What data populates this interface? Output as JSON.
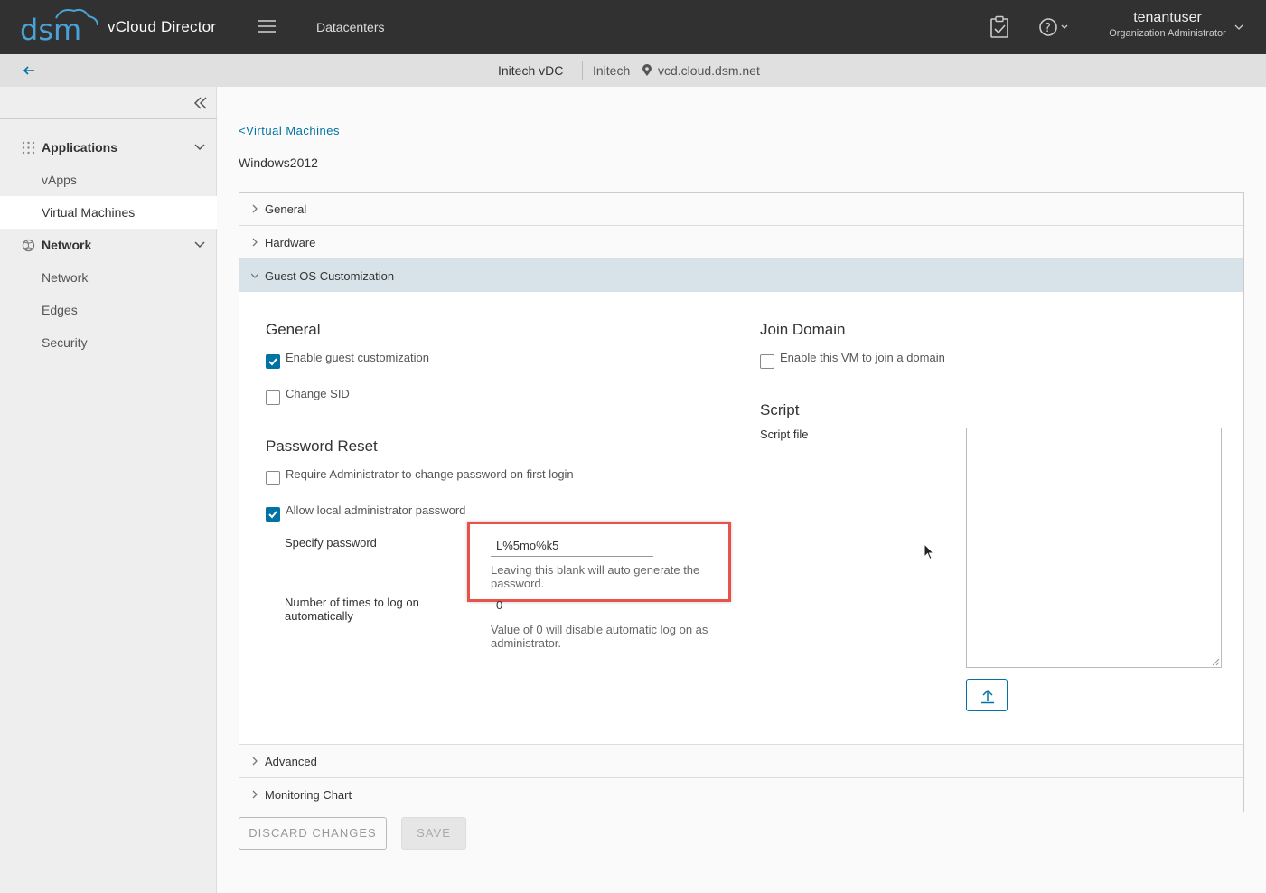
{
  "header": {
    "app_title": "vCloud Director",
    "nav_datacenters": "Datacenters",
    "user_name": "tenantuser",
    "user_role": "Organization Administrator"
  },
  "subheader": {
    "vdc": "Initech vDC",
    "org": "Initech",
    "host": "vcd.cloud.dsm.net"
  },
  "sidebar": {
    "groups": [
      {
        "label": "Applications",
        "items": [
          "vApps",
          "Virtual Machines"
        ]
      },
      {
        "label": "Network",
        "items": [
          "Network",
          "Edges",
          "Security"
        ]
      }
    ],
    "active_item": "Virtual Machines"
  },
  "main": {
    "breadcrumb": "<Virtual Machines",
    "title": "Windows2012",
    "sections": [
      "General",
      "Hardware",
      "Guest OS Customization",
      "Advanced",
      "Monitoring Chart"
    ],
    "open_section": "Guest OS Customization"
  },
  "guest_os": {
    "general_title": "General",
    "enable_customization_label": "Enable guest customization",
    "enable_customization_checked": true,
    "change_sid_label": "Change SID",
    "change_sid_checked": false,
    "password_reset_title": "Password Reset",
    "require_admin_change_label": "Require Administrator to change password on first login",
    "require_admin_change_checked": false,
    "allow_local_admin_label": "Allow local administrator password",
    "allow_local_admin_checked": true,
    "specify_password_label": "Specify password",
    "password_value": "L%5mo%k5",
    "password_help": "Leaving this blank will auto generate the password.",
    "autologon_label": "Number of times to log on automatically",
    "autologon_value": "0",
    "autologon_help": "Value of 0 will disable automatic log on as administrator.",
    "join_domain_title": "Join Domain",
    "join_domain_label": "Enable this VM to join a domain",
    "join_domain_checked": false,
    "script_title": "Script",
    "script_file_label": "Script file"
  },
  "buttons": {
    "discard": "DISCARD CHANGES",
    "save": "SAVE"
  },
  "icons": {
    "logo": "dsm-logo",
    "menu": "hamburger-icon",
    "tasks": "clipboard-check-icon",
    "help": "help-circle-icon",
    "back": "arrow-left-icon",
    "collapse": "double-chevron-left-icon",
    "upload": "upload-icon"
  },
  "colors": {
    "header_bg": "#313131",
    "accent": "#0072a3",
    "highlight": "#e8524a",
    "open_section_bg": "#d8e3e9"
  }
}
